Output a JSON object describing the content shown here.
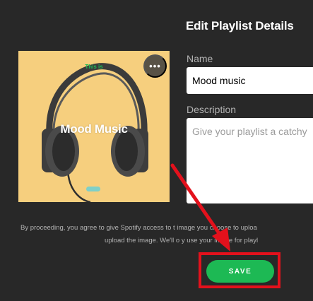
{
  "dialog": {
    "title": "Edit Playlist Details",
    "more_options_label": "•••"
  },
  "cover": {
    "small_text": "This is",
    "title": "Mood Music",
    "background_color": "#f6cf7e",
    "icon": "headphones"
  },
  "fields": {
    "name_label": "Name",
    "name_value": "Mood music",
    "description_label": "Description",
    "description_placeholder": "Give your playlist a catchy"
  },
  "disclaimer": {
    "line1": "By proceeding, you agree to give Spotify access to t​  image you choose to uploa",
    "line2": "upload the image. We'll o​   y use your image for playl"
  },
  "save_button": {
    "label": "SAVE",
    "color": "#1db954"
  },
  "annotation": {
    "color": "#e3111c"
  }
}
